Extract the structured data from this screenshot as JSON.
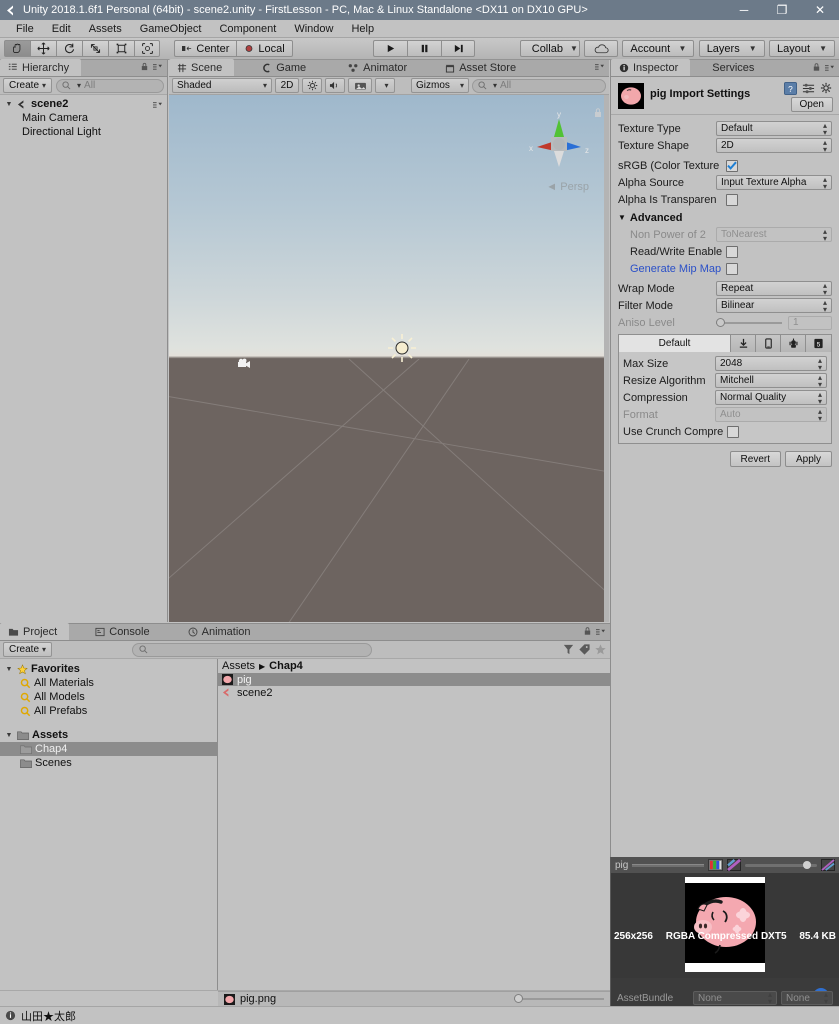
{
  "titlebar": {
    "title": "Unity 2018.1.6f1 Personal (64bit) - scene2.unity - FirstLesson - PC, Mac & Linux Standalone <DX11 on DX10 GPU>",
    "minimize": "─",
    "maximize": "❐",
    "close": "✕"
  },
  "menubar": {
    "items": [
      "File",
      "Edit",
      "Assets",
      "GameObject",
      "Component",
      "Window",
      "Help"
    ]
  },
  "toolbar": {
    "tools": [
      "hand-tool",
      "move-tool",
      "rotate-tool",
      "scale-tool",
      "rect-tool",
      "transform-tool"
    ],
    "pivot_mode": "Center",
    "pivot_rotation": "Local",
    "play": "▶",
    "pause": "❙❙",
    "step": "▶❘",
    "collab": "Collab",
    "cloud": "cloud-icon",
    "account": "Account",
    "layers": "Layers",
    "layout": "Layout"
  },
  "hierarchy": {
    "tab": "Hierarchy",
    "create": "Create",
    "search_placeholder": "All",
    "scene_name": "scene2",
    "items": [
      "Main Camera",
      "Directional Light"
    ]
  },
  "sceneview": {
    "tabs": [
      {
        "label": "Scene",
        "active": true
      },
      {
        "label": "Game",
        "active": false
      },
      {
        "label": "Animator",
        "active": false
      },
      {
        "label": "Asset Store",
        "active": false
      }
    ],
    "draw_mode": "Shaded",
    "two_d": "2D",
    "lighting": "lighting-icon",
    "audio": "audio-icon",
    "effects": "effects-icon",
    "gizmos": "Gizmos",
    "search_placeholder": "All",
    "gizmo_axes": {
      "x": "x",
      "y": "y",
      "z": "z"
    },
    "projection": "Persp"
  },
  "inspector": {
    "tabs": [
      {
        "label": "Inspector",
        "active": true
      },
      {
        "label": "Services",
        "active": false
      }
    ],
    "title": "pig Import Settings",
    "open_button": "Open",
    "fields": {
      "texture_type": {
        "label": "Texture Type",
        "value": "Default"
      },
      "texture_shape": {
        "label": "Texture Shape",
        "value": "2D"
      },
      "srgb": {
        "label": "sRGB (Color Texture",
        "checked": true
      },
      "alpha_source": {
        "label": "Alpha Source",
        "value": "Input Texture Alpha"
      },
      "alpha_is_transparent": {
        "label": "Alpha Is Transparen",
        "checked": false
      },
      "advanced": {
        "label": "Advanced"
      },
      "non_power_of_2": {
        "label": "Non Power of 2",
        "value": "ToNearest"
      },
      "read_write": {
        "label": "Read/Write Enablе",
        "checked": false
      },
      "generate_mip_map": {
        "label": "Generate Mip Map",
        "checked": false
      },
      "wrap_mode": {
        "label": "Wrap Mode",
        "value": "Repeat"
      },
      "filter_mode": {
        "label": "Filter Mode",
        "value": "Bilinear"
      },
      "aniso_level": {
        "label": "Aniso Level",
        "value": "1"
      }
    },
    "platform": {
      "default_tab": "Default",
      "icon_tabs": [
        "standalone-icon",
        "ios-icon",
        "android-icon",
        "webgl-icon"
      ],
      "max_size": {
        "label": "Max Size",
        "value": "2048"
      },
      "resize_algorithm": {
        "label": "Resize Algorithm",
        "value": "Mitchell"
      },
      "compression": {
        "label": "Compression",
        "value": "Normal Quality"
      },
      "format": {
        "label": "Format",
        "value": "Auto"
      },
      "use_crunch": {
        "label": "Use Crunch Compre",
        "checked": false
      }
    },
    "revert": "Revert",
    "apply": "Apply"
  },
  "preview": {
    "name": "pig",
    "dimensions": "256x256",
    "format": "RGBA Compressed DXT5",
    "size": "85.4 KB",
    "assetbundle_label": "AssetBundle",
    "assetbundle_value": "None",
    "assetbundle_variant": "None"
  },
  "project": {
    "tabs": [
      {
        "label": "Project",
        "active": true
      },
      {
        "label": "Console",
        "active": false
      },
      {
        "label": "Animation",
        "active": false
      }
    ],
    "create": "Create",
    "search_placeholder": "",
    "favorites_label": "Favorites",
    "favorites": [
      "All Materials",
      "All Models",
      "All Prefabs"
    ],
    "assets_label": "Assets",
    "folders": [
      {
        "label": "Chap4",
        "selected": true
      },
      {
        "label": "Scenes",
        "selected": false
      }
    ],
    "breadcrumb": [
      "Assets",
      "Chap4"
    ],
    "items": [
      {
        "label": "pig",
        "type": "texture",
        "selected": true
      },
      {
        "label": "scene2",
        "type": "scene",
        "selected": false
      }
    ],
    "footer_file": "pig.png"
  },
  "statusbar": {
    "message": "山田★太郎"
  },
  "colors": {
    "titlebar": "#6c7a89",
    "panel": "#c2c2c2",
    "selection": "#8c8c8c",
    "link": "#2b50c8",
    "preview_bg": "#383838"
  }
}
